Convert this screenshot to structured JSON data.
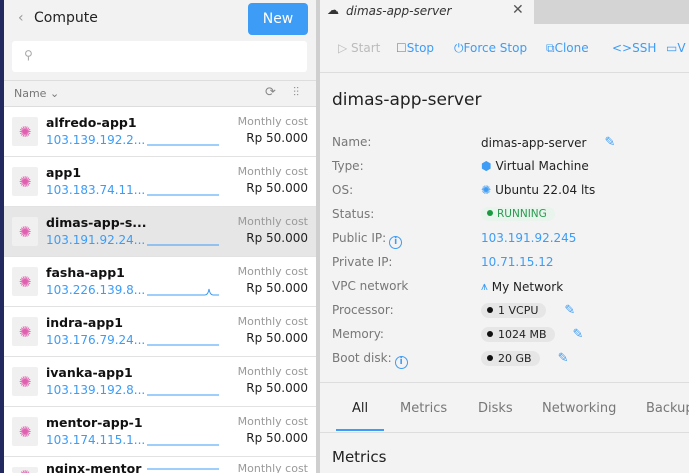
{
  "sidebar": {
    "title": "Compute",
    "new_label": "New",
    "search_placeholder": "",
    "sort_label": "Name ⌄",
    "items": [
      {
        "name": "alfredo-app1",
        "ip": "103.139.192.2...",
        "cost_label": "Monthly cost",
        "cost": "Rp 50.000",
        "spike": false
      },
      {
        "name": "app1",
        "ip": "103.183.74.11...",
        "cost_label": "Monthly cost",
        "cost": "Rp 50.000",
        "spike": false
      },
      {
        "name": "dimas-app-s...",
        "ip": "103.191.92.24...",
        "cost_label": "Monthly cost",
        "cost": "Rp 50.000",
        "spike": false,
        "selected": true
      },
      {
        "name": "fasha-app1",
        "ip": "103.226.139.8...",
        "cost_label": "Monthly cost",
        "cost": "Rp 50.000",
        "spike": true
      },
      {
        "name": "indra-app1",
        "ip": "103.176.79.24...",
        "cost_label": "Monthly cost",
        "cost": "Rp 50.000",
        "spike": false
      },
      {
        "name": "ivanka-app1",
        "ip": "103.139.192.8...",
        "cost_label": "Monthly cost",
        "cost": "Rp 50.000",
        "spike": false
      },
      {
        "name": "mentor-app-1",
        "ip": "103.174.115.1...",
        "cost_label": "Monthly cost",
        "cost": "Rp 50.000",
        "spike": false
      },
      {
        "name": "nginx-mentor",
        "ip": "",
        "cost_label": "Monthly cost",
        "cost": "",
        "spike": false
      }
    ]
  },
  "tab": {
    "title": "dimas-app-server"
  },
  "toolbar": {
    "start": "Start",
    "stop": "Stop",
    "force_stop": "Force Stop",
    "clone": "Clone",
    "ssh": "SSH",
    "vnc": "V"
  },
  "detail": {
    "title": "dimas-app-server",
    "labels": {
      "name": "Name:",
      "type": "Type:",
      "os": "OS:",
      "status": "Status:",
      "public_ip": "Public IP:",
      "private_ip": "Private IP:",
      "vpc": "VPC network",
      "processor": "Processor:",
      "memory": "Memory:",
      "boot_disk": "Boot disk:"
    },
    "values": {
      "name": "dimas-app-server",
      "type": "Virtual Machine",
      "os": "Ubuntu 22.04 lts",
      "status": "RUNNING",
      "public_ip": "103.191.92.245",
      "private_ip": "10.71.15.12",
      "vpc": "My Network",
      "processor": "1 VCPU",
      "memory": "1024 MB",
      "boot_disk": "20 GB"
    }
  },
  "sections": {
    "tabs": [
      "All",
      "Metrics",
      "Disks",
      "Networking",
      "Backup"
    ],
    "active": "All",
    "heading": "Metrics"
  },
  "colors": {
    "accent": "#3d9cf5",
    "running": "#2a9a50",
    "ubuntu": "#e060b0"
  }
}
